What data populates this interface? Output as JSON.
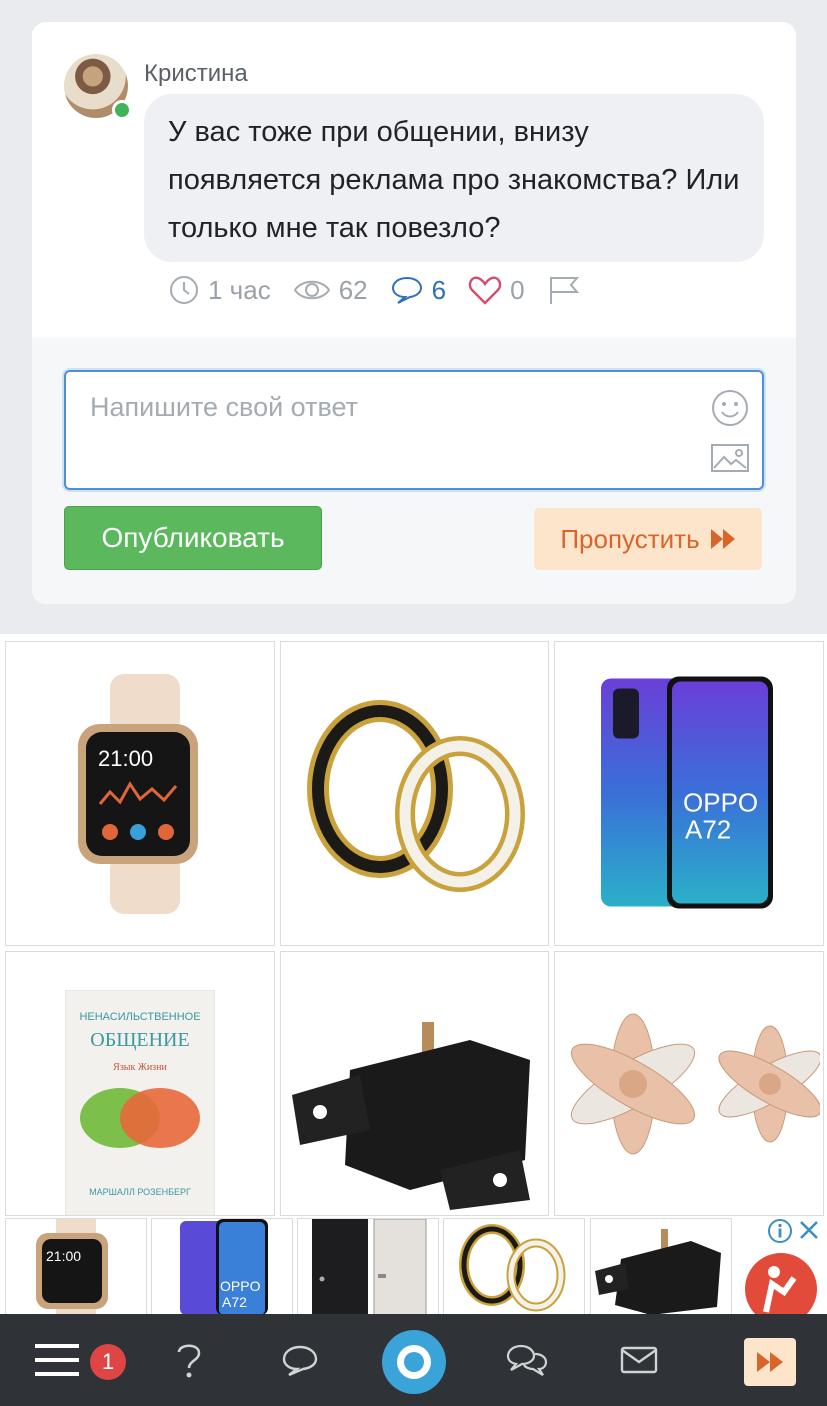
{
  "post": {
    "author": "Кристина",
    "text": "У вас тоже при общении, внизу появляется реклама про знакомства? Или только мне так повезло?",
    "time": "1 час",
    "views": "62",
    "comments": "6",
    "likes": "0"
  },
  "reply": {
    "placeholder": "Напишите свой ответ",
    "publish_label": "Опубликовать",
    "skip_label": "Пропустить"
  },
  "ads": {
    "grid": [
      "smartwatch",
      "rings",
      "smartphone",
      "book",
      "engine-mount",
      "earrings"
    ],
    "book_title": "НЕНАСИЛЬСТВЕННОЕ ОБЩЕНИЕ",
    "book_subtitle": "Язык Жизни",
    "book_author": "МАРШАЛЛ РОЗЕНБЕРГ",
    "phone_brand": "OPPO",
    "phone_model": "A72",
    "watch_time": "21:00"
  },
  "nav": {
    "badge_count": "1"
  },
  "colors": {
    "accent_blue": "#2f6fbd",
    "publish_green": "#5cb85c",
    "skip_orange": "#d9652a",
    "like_red": "#d64a6a"
  }
}
